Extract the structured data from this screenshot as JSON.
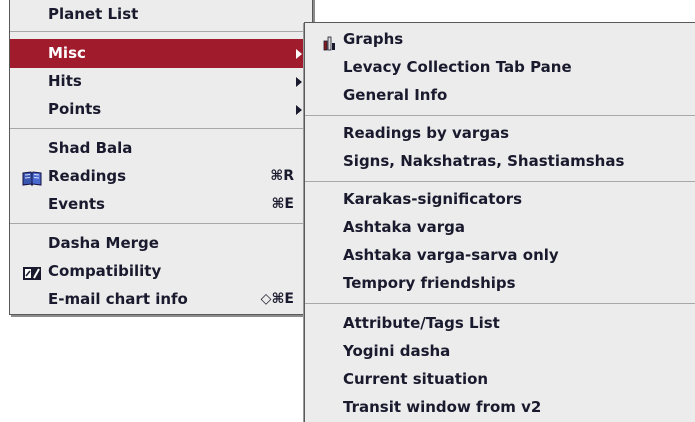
{
  "main_menu": {
    "top_item": "Planet List",
    "misc": "Misc",
    "hits": "Hits",
    "points": "Points",
    "shad_bala": "Shad Bala",
    "readings": "Readings",
    "readings_shortcut": "⌘R",
    "events": "Events",
    "events_shortcut": "⌘E",
    "dasha_merge": "Dasha Merge",
    "compatibility": "Compatibility",
    "email_chart_info": "E-mail chart info",
    "email_shortcut": "◇⌘E"
  },
  "sub_menu": {
    "graphs": "Graphs",
    "legacy_tab_pane": "Levacy Collection Tab Pane",
    "general_info": "General Info",
    "readings_by_vargas": "Readings by vargas",
    "signs_nakshatras": "Signs, Nakshatras, Shastiamshas",
    "karakas": "Karakas-significators",
    "ashtaka_varga": "Ashtaka varga",
    "ashtaka_varga_sarva": "Ashtaka varga-sarva only",
    "tempory_friendships": "Tempory friendships",
    "attribute_tags_list": "Attribute/Tags List",
    "yogini_dasha": "Yogini dasha",
    "current_situation": "Current situation",
    "transit_window": "Transit window from v2"
  },
  "icons": {
    "readings": "book-icon",
    "compatibility": "compatibility-icon",
    "graphs": "graph-icon"
  },
  "colors": {
    "menu_background": "#ececec",
    "selection_highlight": "#a01c2c",
    "text": "#1a1a2e"
  }
}
